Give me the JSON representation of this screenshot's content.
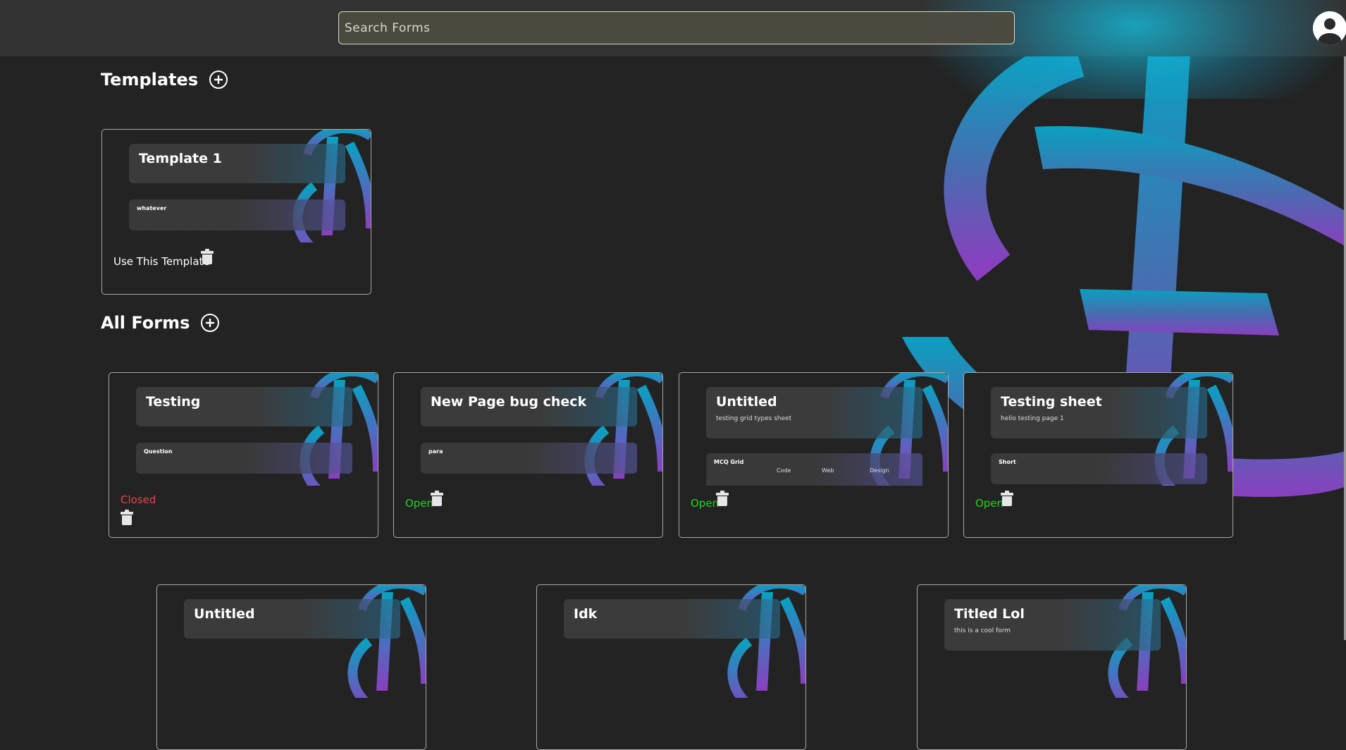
{
  "search": {
    "placeholder": "Search Forms"
  },
  "sections": {
    "templates": {
      "title": "Templates"
    },
    "all_forms": {
      "title": "All Forms"
    }
  },
  "templates": [
    {
      "title": "Template 1",
      "question": "whatever",
      "action_label": "Use This Template"
    }
  ],
  "forms": [
    {
      "title": "Testing",
      "description": "",
      "question": "Question",
      "status": "Closed"
    },
    {
      "title": "New Page bug check",
      "description": "",
      "question": "para",
      "status": "Open"
    },
    {
      "title": "Untitled",
      "description": "testing grid types sheet",
      "question": "MCQ Grid",
      "grid_columns": [
        "Code",
        "Web",
        "Design"
      ],
      "status": "Open"
    },
    {
      "title": "Testing sheet",
      "description": "hello testing page 1",
      "question": "Short",
      "status": "Open"
    },
    {
      "title": "Untitled",
      "description": ""
    },
    {
      "title": "Idk",
      "description": ""
    },
    {
      "title": "Titled Lol",
      "description": "this is a cool form"
    }
  ],
  "icons": {
    "add": "plus-circle-icon",
    "delete": "trash-icon",
    "avatar": "user-avatar-icon",
    "logo": "brand-logo"
  },
  "colors": {
    "background": "#232323",
    "topbar": "#323232",
    "open": "#1cd81c",
    "closed": "#e04848",
    "logo_top": "#0aa0c0",
    "logo_bottom": "#8a3fbf"
  }
}
